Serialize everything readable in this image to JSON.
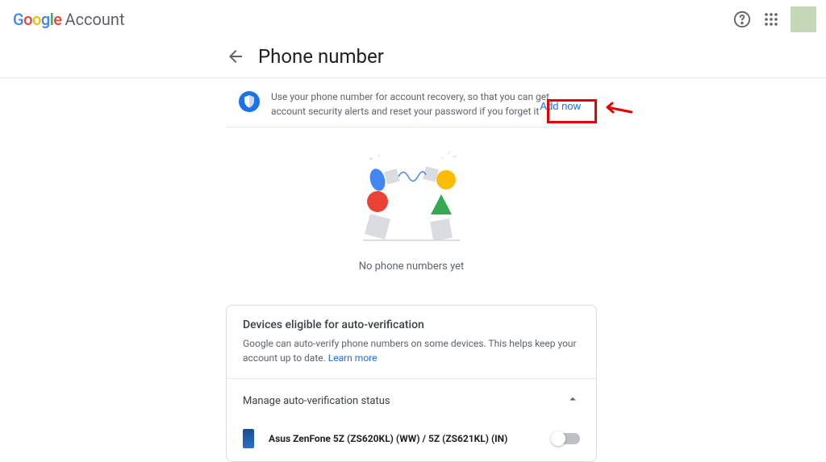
{
  "header": {
    "brand": "Account"
  },
  "page": {
    "title": "Phone number",
    "info_text": "Use your phone number for account recovery, so that you can get account security alerts and reset your password if you forget it",
    "add_now_label": "Add now",
    "empty_state": "No phone numbers yet"
  },
  "devices": {
    "title": "Devices eligible for auto-verification",
    "description": "Google can auto-verify phone numbers on some devices. This helps keep your account up to date. ",
    "learn_more": "Learn more",
    "manage_label": "Manage auto-verification status",
    "items": [
      {
        "name": "Asus ZenFone 5Z (ZS620KL) (WW) / 5Z (ZS621KL) (IN)",
        "enabled": false
      }
    ]
  }
}
